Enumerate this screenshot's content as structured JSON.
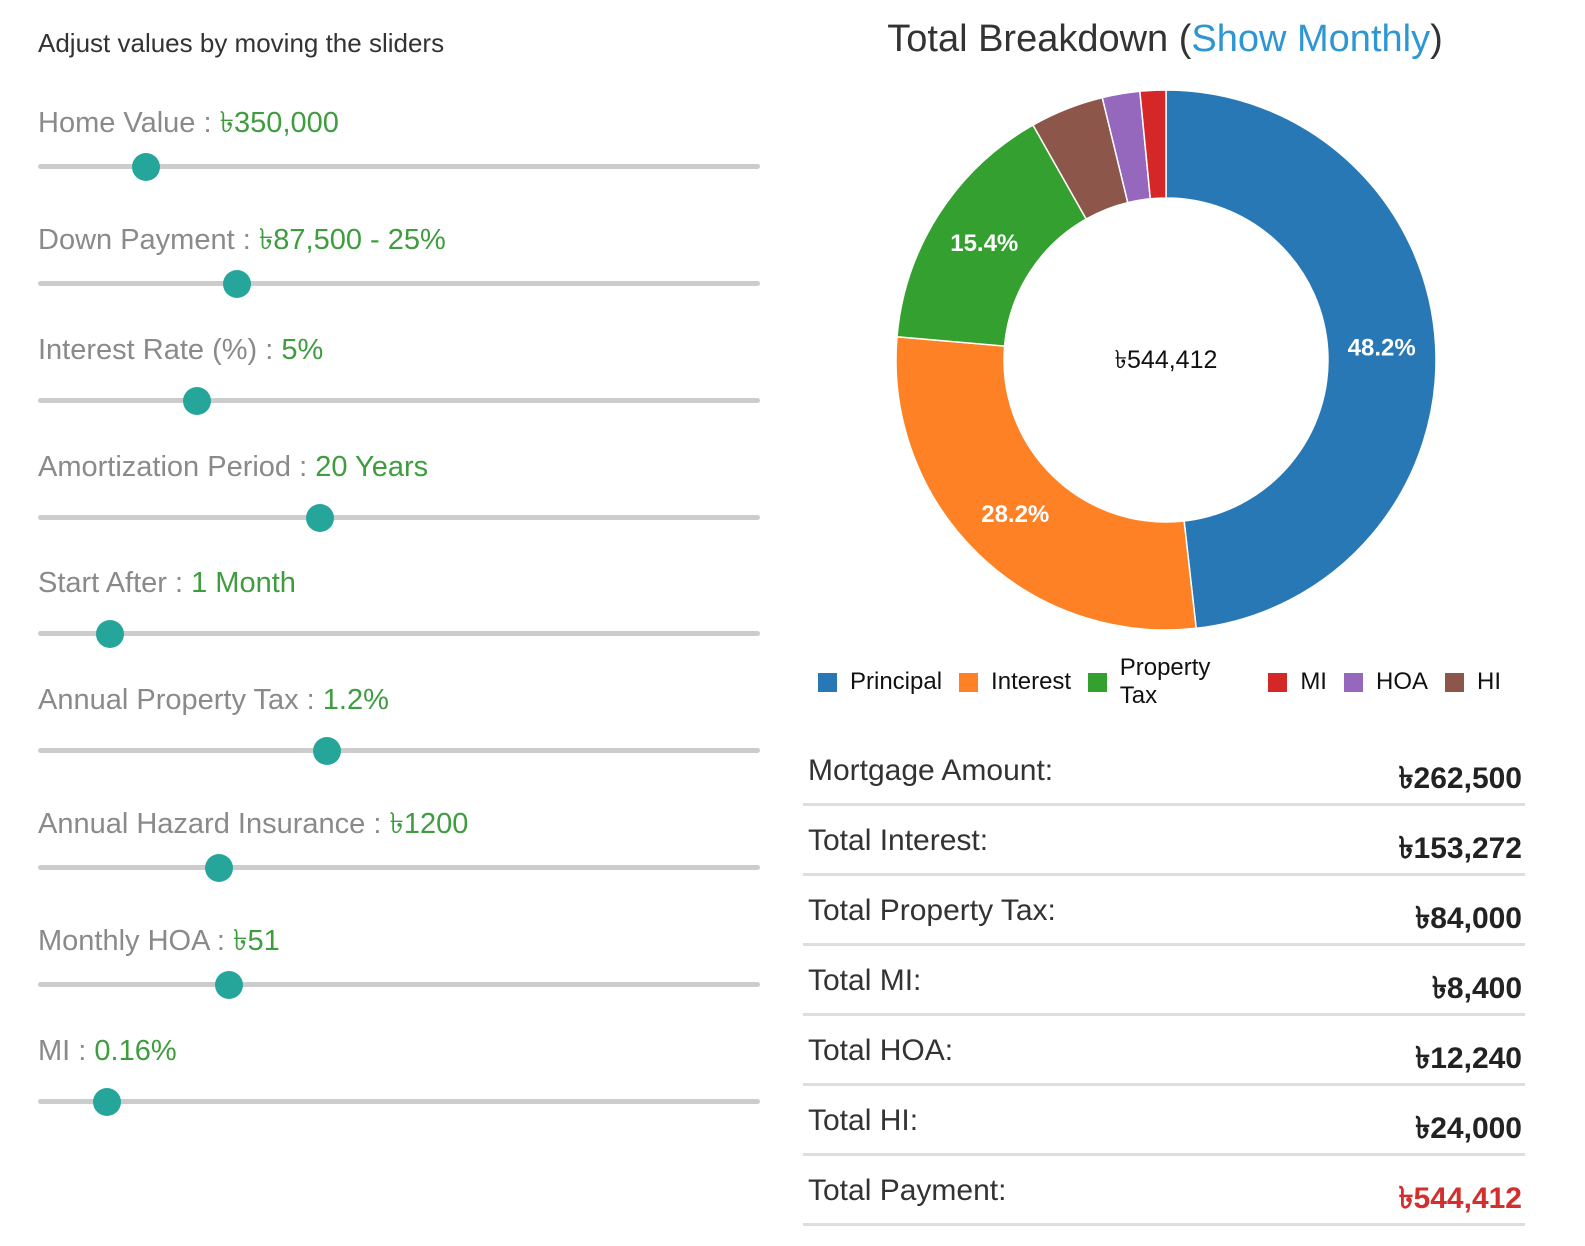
{
  "instructions": "Adjust values by moving the sliders",
  "sliders": [
    {
      "label": "Home Value",
      "value": "৳350,000",
      "position": 0.15
    },
    {
      "label": "Down Payment",
      "value": "৳87,500 - 25%",
      "position": 0.275
    },
    {
      "label": "Interest Rate (%)",
      "value": "5%",
      "position": 0.22
    },
    {
      "label": "Amortization Period",
      "value": "20 Years",
      "position": 0.39
    },
    {
      "label": "Start After",
      "value": "1 Month",
      "position": 0.1
    },
    {
      "label": "Annual Property Tax",
      "value": "1.2%",
      "position": 0.4
    },
    {
      "label": "Annual Hazard Insurance",
      "value": "৳1200",
      "position": 0.25
    },
    {
      "label": "Monthly HOA",
      "value": "৳51",
      "position": 0.265
    },
    {
      "label": "MI",
      "value": "0.16%",
      "position": 0.095
    }
  ],
  "colors": {
    "slider_thumb": "#26a69a",
    "slider_value": "#3f9c3f",
    "link": "#2f96d4",
    "total_value": "#d32f2f"
  },
  "breakdown": {
    "title": "Total Breakdown",
    "toggle_link": "Show Monthly",
    "open_paren": "(",
    "close_paren": ")"
  },
  "chart_data": {
    "type": "pie",
    "donut": true,
    "center_label": "৳544,412",
    "slices": [
      {
        "name": "Principal",
        "value": 262500,
        "percent_label": "48.2%",
        "color": "#2878b5"
      },
      {
        "name": "Interest",
        "value": 153272,
        "percent_label": "28.2%",
        "color": "#fe8125"
      },
      {
        "name": "Property Tax",
        "value": 84000,
        "percent_label": "15.4%",
        "color": "#33a02f"
      },
      {
        "name": "HI",
        "value": 24000,
        "percent_label": "",
        "color": "#8c564b"
      },
      {
        "name": "HOA",
        "value": 12240,
        "percent_label": "",
        "color": "#9567bd"
      },
      {
        "name": "MI",
        "value": 8400,
        "percent_label": "",
        "color": "#d62728"
      }
    ],
    "legend": [
      {
        "name": "Principal",
        "color": "#2878b5"
      },
      {
        "name": "Interest",
        "color": "#fe8125"
      },
      {
        "name": "Property Tax",
        "color": "#33a02f"
      },
      {
        "name": "MI",
        "color": "#d62728"
      },
      {
        "name": "HOA",
        "color": "#9567bd"
      },
      {
        "name": "HI",
        "color": "#8c564b"
      }
    ],
    "legend_position": "bottom"
  },
  "summary": [
    {
      "label": "Mortgage Amount:",
      "value": "৳262,500"
    },
    {
      "label": "Total Interest:",
      "value": "৳153,272"
    },
    {
      "label": "Total Property Tax:",
      "value": "৳84,000"
    },
    {
      "label": "Total MI:",
      "value": "৳8,400"
    },
    {
      "label": "Total HOA:",
      "value": "৳12,240"
    },
    {
      "label": "Total HI:",
      "value": "৳24,000"
    },
    {
      "label": "Total Payment:",
      "value": "৳544,412",
      "highlight": true
    }
  ]
}
